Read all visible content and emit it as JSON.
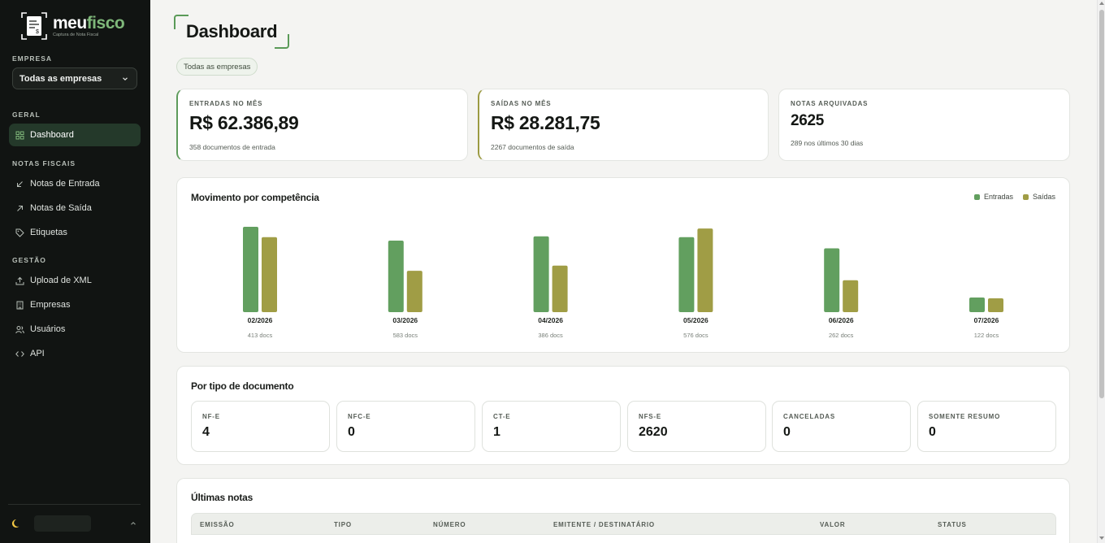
{
  "brand": {
    "name_part1": "meu",
    "name_part2": "fisco",
    "tagline": "Captura de Nota Fiscal"
  },
  "sidebar": {
    "company_label": "EMPRESA",
    "company_select": "Todas as empresas",
    "sections": [
      {
        "label": "GERAL",
        "items": [
          {
            "label": "Dashboard",
            "icon": "grid-icon",
            "active": true
          }
        ]
      },
      {
        "label": "NOTAS FISCAIS",
        "items": [
          {
            "label": "Notas de Entrada",
            "icon": "arrow-down-left-icon"
          },
          {
            "label": "Notas de Saída",
            "icon": "arrow-up-right-icon"
          },
          {
            "label": "Etiquetas",
            "icon": "tag-icon"
          }
        ]
      },
      {
        "label": "GESTÃO",
        "items": [
          {
            "label": "Upload de XML",
            "icon": "upload-icon"
          },
          {
            "label": "Empresas",
            "icon": "building-icon"
          },
          {
            "label": "Usuários",
            "icon": "users-icon"
          },
          {
            "label": "API",
            "icon": "code-icon"
          }
        ]
      }
    ],
    "theme_icon": "moon-icon"
  },
  "header": {
    "title": "Dashboard",
    "filter_chip": "Todas as empresas"
  },
  "stats": [
    {
      "label": "ENTRADAS NO MÊS",
      "value": "R$ 62.386,89",
      "sub": "358 documentos de entrada",
      "accent": "#5d9b5b"
    },
    {
      "label": "SAÍDAS NO MÊS",
      "value": "R$ 28.281,75",
      "sub": "2267 documentos de saída",
      "accent": "#9b9a42"
    },
    {
      "label": "NOTAS ARQUIVADAS",
      "value": "2625",
      "sub": "289 nos últimos 30 dias",
      "accent": ""
    }
  ],
  "movement": {
    "title": "Movimento por competência",
    "legend": [
      {
        "name": "Entradas",
        "color": "#629f5f"
      },
      {
        "name": "Saídas",
        "color": "#a09d45"
      }
    ]
  },
  "chart_data": {
    "type": "bar",
    "categories": [
      "02/2026",
      "03/2026",
      "04/2026",
      "05/2026",
      "06/2026",
      "07/2026"
    ],
    "category_sublabels": [
      "413 docs",
      "583 docs",
      "386 docs",
      "576 docs",
      "262 docs",
      "122 docs"
    ],
    "series": [
      {
        "name": "Entradas",
        "color": "#629f5f",
        "values": [
          0.99,
          0.83,
          0.88,
          0.87,
          0.74,
          0.17
        ]
      },
      {
        "name": "Saídas",
        "color": "#a09d45",
        "values": [
          0.87,
          0.48,
          0.54,
          0.97,
          0.37,
          0.16
        ]
      }
    ],
    "ylim": [
      0,
      1
    ],
    "grid": false,
    "axes_visible": false,
    "legend_position": "top-right"
  },
  "doc_types": {
    "title": "Por tipo de documento",
    "items": [
      {
        "label": "NF-E",
        "value": "4"
      },
      {
        "label": "NFC-E",
        "value": "0"
      },
      {
        "label": "CT-E",
        "value": "1"
      },
      {
        "label": "NFS-E",
        "value": "2620"
      },
      {
        "label": "CANCELADAS",
        "value": "0"
      },
      {
        "label": "SOMENTE RESUMO",
        "value": "0"
      }
    ]
  },
  "latest": {
    "title": "Últimas notas",
    "columns": [
      "EMISSÃO",
      "TIPO",
      "NÚMERO",
      "EMITENTE / DESTINATÁRIO",
      "VALOR",
      "STATUS"
    ]
  }
}
